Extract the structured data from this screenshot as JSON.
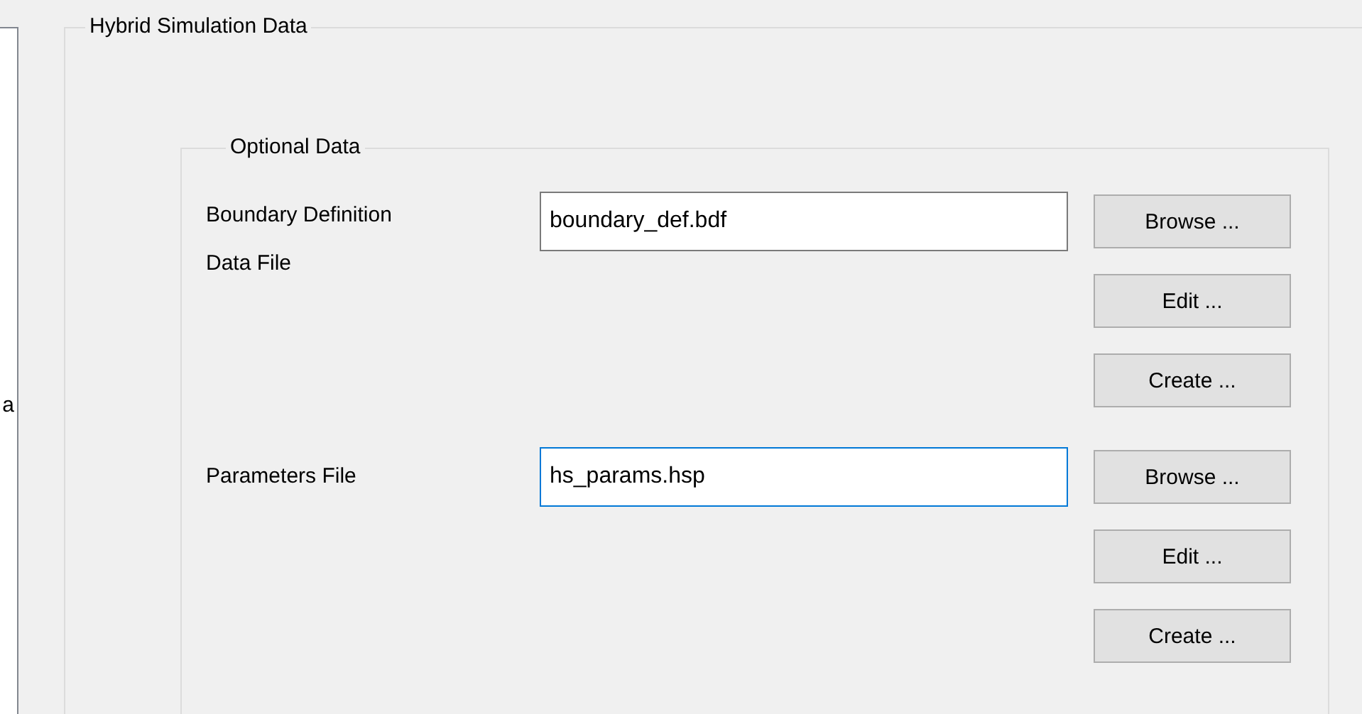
{
  "left_panel": {
    "text": "a"
  },
  "group": {
    "title": "Hybrid Simulation Data",
    "optional_group": {
      "title": "Optional Data",
      "rows": [
        {
          "label": "Boundary Definition\nData File",
          "value": "boundary_def.bdf",
          "focused": false,
          "buttons": [
            "Browse ...",
            "Edit ...",
            "Create ..."
          ]
        },
        {
          "label": "Parameters File",
          "value": "hs_params.hsp",
          "focused": true,
          "buttons": [
            "Browse ...",
            "Edit ...",
            "Create ..."
          ]
        }
      ]
    }
  }
}
